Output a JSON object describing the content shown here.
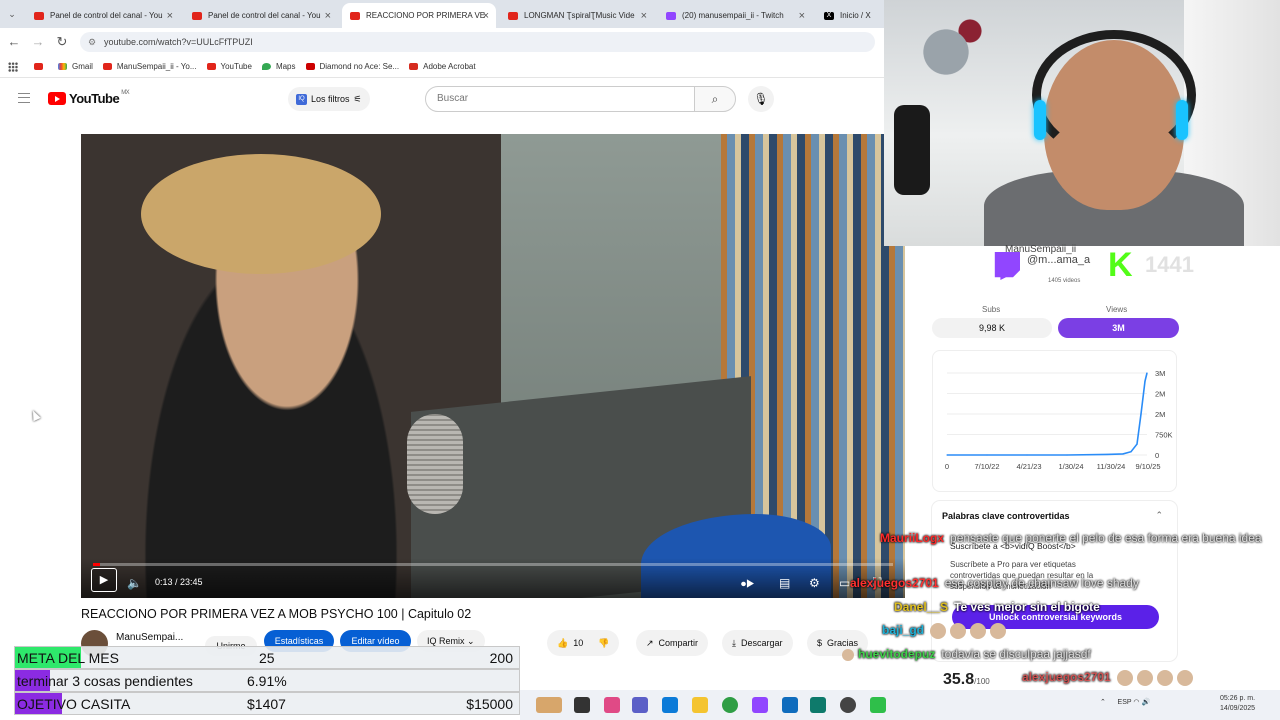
{
  "browser": {
    "tabs": [
      {
        "label": "Panel de control del canal - You",
        "active": false
      },
      {
        "label": "Panel de control del canal - You",
        "active": false
      },
      {
        "label": "REACCIONO POR PRIMERA VE",
        "active": true
      },
      {
        "label": "LONGMAN ƮspiralƮMusic Vide",
        "active": false
      },
      {
        "label": "(20) manusempaii_ii - Twitch",
        "active": false
      },
      {
        "label": "Inicio / X",
        "active": false
      }
    ],
    "url": "youtube.com/watch?v=UULcFfTPUZI",
    "bookmarks": [
      "Gmail",
      "ManuSempaii_ii - Yo...",
      "YouTube",
      "Maps",
      "Diamond no Ace: Se...",
      "Adobe Acrobat"
    ]
  },
  "youtube": {
    "logo": "YouTube",
    "region": "MX",
    "filters_label": "Los filtros",
    "search_placeholder": "Buscar",
    "video_time": "0:13 / 23:45",
    "progress_fraction": 0.009,
    "video_title": "REACCIONO POR PRIMERA VEZ A MOB PSYCHO 100 | Capitulo 02",
    "channel_name": "ManuSempai...",
    "join_label": "Unirme",
    "stats_label": "Estadísticas",
    "edit_label": "Editar vídeo",
    "remix_label": "Remix",
    "likes": "10",
    "share_label": "Compartir",
    "download_label": "Descargar",
    "thanks_label": "Gracias"
  },
  "overlay": {
    "rows": [
      {
        "label": "META DEL MES",
        "mid": "25",
        "end": "200",
        "fill": 0.13,
        "color": "#2ee86b"
      },
      {
        "label": "terminar 3 cosas pendientes",
        "mid": "6.91%",
        "end": "",
        "fill": 0.07,
        "color": "#8b2be2"
      },
      {
        "label": "OJETIVO CASITA",
        "mid": "$1407",
        "end": "$15000",
        "fill": 0.094,
        "color": "#8b2be2"
      }
    ]
  },
  "stats_panel": {
    "handle_top": "ManuSempaii_ii",
    "handle": "@m...ama_a",
    "video_count": "1405 videos",
    "kick_count": "1441",
    "subs_label": "Subs",
    "subs_value": "9,98 K",
    "views_label": "Views",
    "views_value": "3M",
    "keywords_title": "Palabras clave controvertidas",
    "keywords_subscribe": "Suscríbete a <b>vidIQ Boost</b>",
    "keywords_desc": "Suscríbete a Pro para ver etiquetas controvertidas que puedan resultar en la suspensión de monetización",
    "unlock_label": "Unlock controversial keywords",
    "score": "35.8",
    "score_max": "/100"
  },
  "chart_data": {
    "type": "line",
    "x": [
      "7/10/22",
      "4/21/23",
      "1/30/24",
      "11/30/24",
      "9/10/25"
    ],
    "x_ticks": [
      "0",
      "7/10/22",
      "4/21/23",
      "1/30/24",
      "11/30/24",
      "9/10/25"
    ],
    "y_ticks": [
      "0",
      "750K",
      "2M",
      "2M",
      "3M"
    ],
    "series": [
      {
        "values": [
          0,
          0,
          0,
          0,
          20000,
          40000,
          120000,
          400000,
          1500000,
          2700000,
          3000000
        ]
      }
    ],
    "points_x_fraction": [
      0,
      0.2,
      0.4,
      0.6,
      0.8,
      0.88,
      0.92,
      0.95,
      0.97,
      0.99,
      1.0
    ],
    "ylim": [
      0,
      3000000
    ],
    "color": "#2a8cf7"
  },
  "chat": [
    {
      "user": "MauriiLogx",
      "color": "#ff2a2a",
      "msg": "pensaste que ponerte el pelo de esa forma era buena idea"
    },
    {
      "user": "alexjuegos2701",
      "color": "#ff3030",
      "msg": "ese cosplay de chainsaw love shady"
    },
    {
      "user": "Danel__S",
      "color": "#e0c020",
      "msg": "Te ves mejor sin el bigote"
    },
    {
      "user": "baji_gd",
      "color": "#1eb2d8",
      "msg": ""
    },
    {
      "user": "huevitodepuz",
      "color": "#3fd14a",
      "msg": "todavia se disculpaa jajjasdf"
    },
    {
      "user": "alexjuegos2701",
      "color": "#ff3030",
      "msg": ""
    }
  ],
  "taskbar": {
    "lang": "ESP",
    "time": "05:26 p. m.",
    "date": "14/09/2025"
  }
}
